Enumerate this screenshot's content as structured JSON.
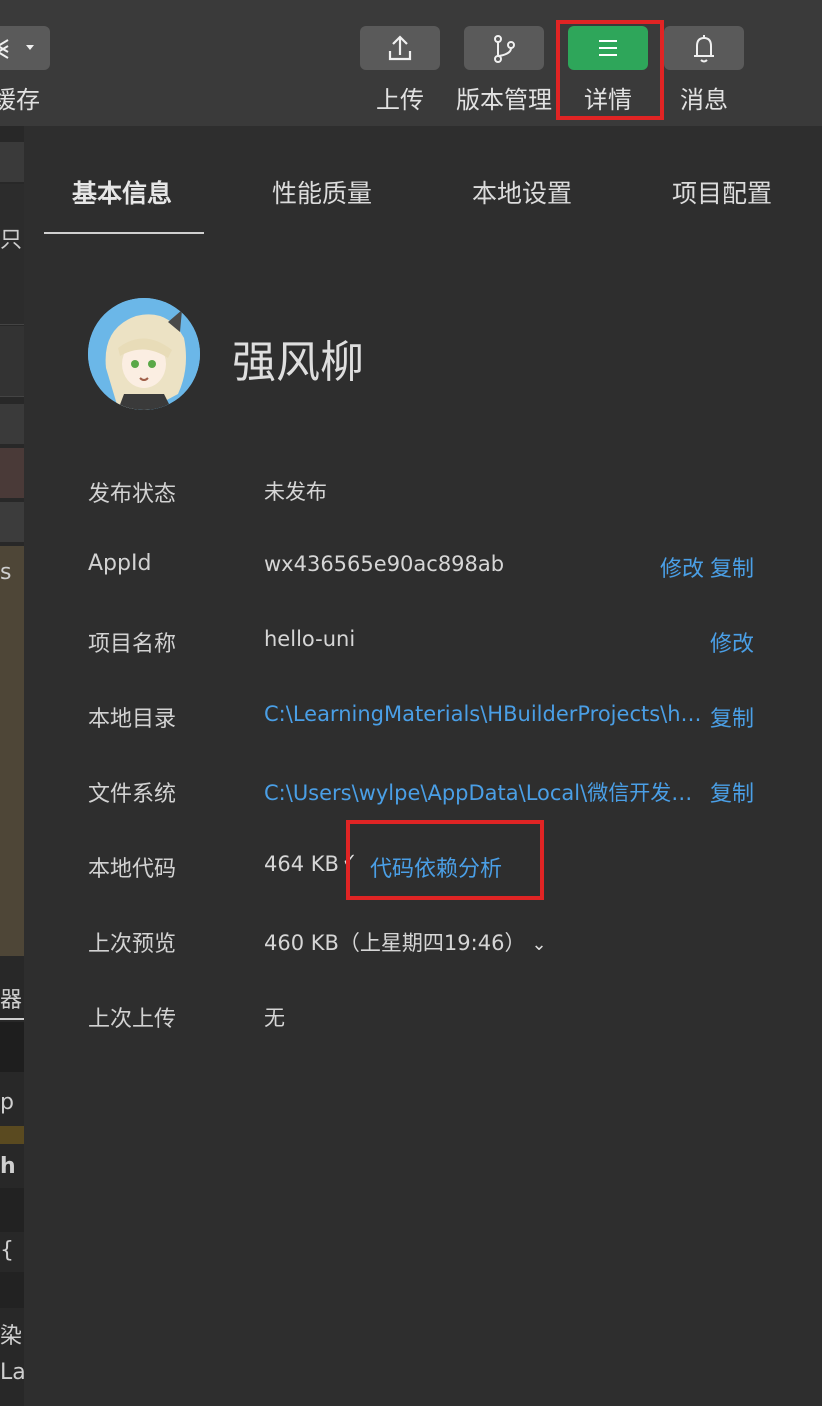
{
  "toolbar": {
    "left_label": "缓存",
    "buttons": [
      {
        "label": "上传",
        "icon": "upload-icon"
      },
      {
        "label": "版本管理",
        "icon": "branch-icon"
      },
      {
        "label": "详情",
        "icon": "menu-icon",
        "active": true
      },
      {
        "label": "消息",
        "icon": "bell-icon"
      }
    ]
  },
  "left_strip": {
    "fragments": [
      "只",
      "s",
      "器",
      "p",
      "h",
      "{",
      "染",
      "La"
    ]
  },
  "tabs": [
    "基本信息",
    "性能质量",
    "本地设置",
    "项目配置"
  ],
  "profile": {
    "name": "强风柳"
  },
  "rows": {
    "publish_status": {
      "label": "发布状态",
      "value": "未发布"
    },
    "appid": {
      "label": "AppId",
      "value": "wx436565e90ac898ab",
      "action1": "修改",
      "action2": "复制"
    },
    "project_name": {
      "label": "项目名称",
      "value": "hello-uni",
      "action1": "修改"
    },
    "local_dir": {
      "label": "本地目录",
      "value": "C:\\LearningMaterials\\HBuilderProjects\\hello...",
      "action": "复制"
    },
    "file_system": {
      "label": "文件系统",
      "value": "C:\\Users\\wylpe\\AppData\\Local\\微信开发者...",
      "action": "复制"
    },
    "local_code": {
      "label": "本地代码",
      "value": "464 KB",
      "link": "代码依赖分析"
    },
    "last_preview": {
      "label": "上次预览",
      "value": "460 KB（上星期四19:46）"
    },
    "last_upload": {
      "label": "上次上传",
      "value": "无"
    }
  },
  "colors": {
    "accent_green": "#2ea65a",
    "link_blue": "#4a9fe6",
    "highlight_red": "#e02424",
    "panel_bg": "#2e2e2e",
    "toolbar_bg": "#3a3a3a"
  }
}
